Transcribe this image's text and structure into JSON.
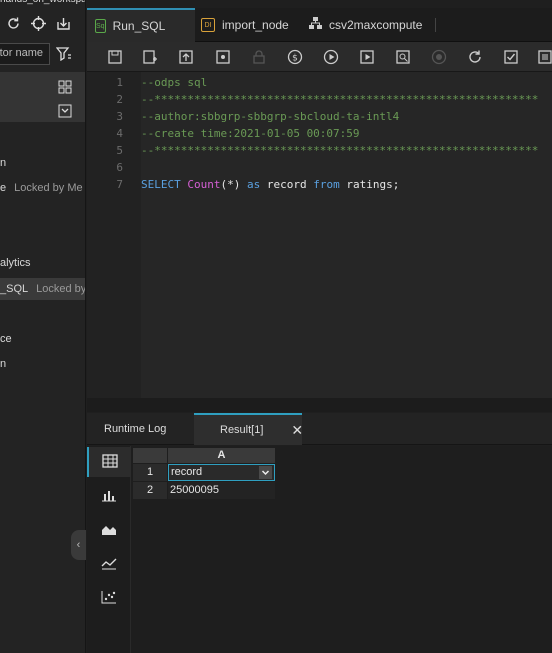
{
  "window": {
    "workspace_title": "hands_on_workspace"
  },
  "sidebar": {
    "search_placeholder": "ator name",
    "rows": [
      {
        "label": "n",
        "lock": ""
      },
      {
        "label": "e",
        "lock": "Locked by Me"
      },
      {
        "label": "alytics",
        "lock": ""
      },
      {
        "label": "_SQL",
        "lock": "Locked by M"
      },
      {
        "label": "ce",
        "lock": ""
      },
      {
        "label": "n",
        "lock": ""
      }
    ]
  },
  "tabs": [
    {
      "label": "Run_SQL",
      "icon": "Sq",
      "active": true
    },
    {
      "label": "import_node",
      "icon": "DI",
      "active": false
    },
    {
      "label": "csv2maxcompute",
      "icon": "flow-icon",
      "active": false
    }
  ],
  "toolbar": {
    "icons": [
      "save-icon",
      "save-as-icon",
      "submit-icon",
      "publish-icon",
      "lock-icon",
      "cost-icon",
      "run-icon",
      "run-params-icon",
      "preview-icon",
      "stop-icon",
      "refresh-icon",
      "format-icon",
      "more-icon"
    ]
  },
  "editor": {
    "lines": [
      {
        "n": "1",
        "text": "--odps sql"
      },
      {
        "n": "2",
        "text": "--**********************************************************"
      },
      {
        "n": "3",
        "text": "--author:sbbgrp-sbbgrp-sbcloud-ta-intl4"
      },
      {
        "n": "4",
        "text": "--create time:2021-01-05 00:07:59"
      },
      {
        "n": "5",
        "text": "--**********************************************************"
      },
      {
        "n": "6",
        "text": ""
      },
      {
        "n": "7",
        "text": ""
      }
    ],
    "sql": {
      "select": "SELECT",
      "count": "Count",
      "args": "(*)",
      "as": "as",
      "alias": "record",
      "from": "from",
      "table": "ratings;"
    }
  },
  "results": {
    "tabs": [
      {
        "label": "Runtime Log"
      },
      {
        "label": "Result[1]"
      }
    ],
    "close": "✕",
    "column": "A",
    "rows": [
      {
        "n": "1",
        "value": "record"
      },
      {
        "n": "2",
        "value": "25000095"
      }
    ]
  },
  "colors": {
    "accent": "#2f9fc0",
    "comment": "#6a9a55",
    "keyword": "#5aa0e0",
    "function": "#d65fd6"
  }
}
